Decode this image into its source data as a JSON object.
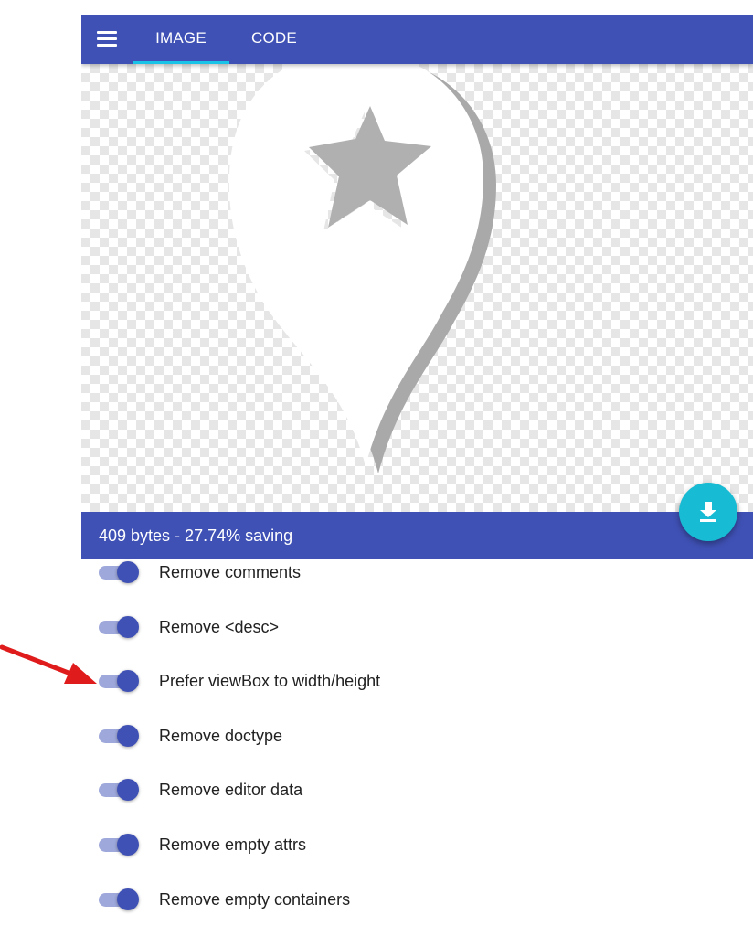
{
  "header": {
    "menu_icon": "hamburger-menu-icon",
    "tabs": [
      {
        "label": "IMAGE",
        "active": true
      },
      {
        "label": "CODE",
        "active": false
      }
    ],
    "accent": "#3f51b5",
    "tab_indicator_color": "#19c3e8"
  },
  "preview": {
    "image": "map-pin-with-star",
    "background": "transparency-checkerboard"
  },
  "status": {
    "text": "409 bytes - 27.74% saving"
  },
  "download_button": {
    "icon": "download-icon",
    "color": "#17bcd4"
  },
  "options": [
    {
      "label": "Remove comments",
      "enabled": true
    },
    {
      "label": "Remove <desc>",
      "enabled": true
    },
    {
      "label": "Prefer viewBox to width/height",
      "enabled": true
    },
    {
      "label": "Remove doctype",
      "enabled": true
    },
    {
      "label": "Remove editor data",
      "enabled": true
    },
    {
      "label": "Remove empty attrs",
      "enabled": true
    },
    {
      "label": "Remove empty containers",
      "enabled": true
    }
  ],
  "annotation": {
    "type": "red-arrow",
    "color": "#e01b1b",
    "points_to": "Prefer viewBox to width/height"
  }
}
